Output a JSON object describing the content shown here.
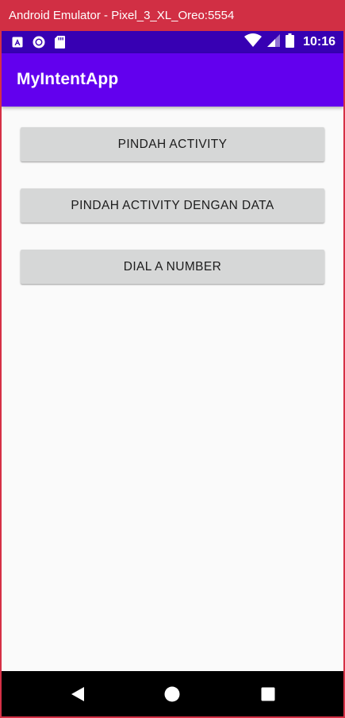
{
  "window": {
    "title": "Android Emulator - Pixel_3_XL_Oreo:5554"
  },
  "status_bar": {
    "time": "10:16",
    "left_icons": [
      "app-notification-icon",
      "record-icon",
      "sd-card-icon"
    ],
    "right_icons": [
      "wifi-icon",
      "signal-icon",
      "battery-icon"
    ]
  },
  "app_bar": {
    "title": "MyIntentApp"
  },
  "buttons": {
    "move_activity": "PINDAH ACTIVITY",
    "move_activity_with_data": "PINDAH ACTIVITY DENGAN DATA",
    "dial_number": "DIAL A NUMBER"
  },
  "nav_bar": {
    "icons": [
      "back-icon",
      "home-icon",
      "recents-icon"
    ]
  },
  "colors": {
    "window_titlebar": "#d12f44",
    "status_bar": "#3700b3",
    "app_bar": "#6200ee",
    "background": "#fafafa",
    "button": "#d6d7d7",
    "nav_bar": "#000000"
  }
}
